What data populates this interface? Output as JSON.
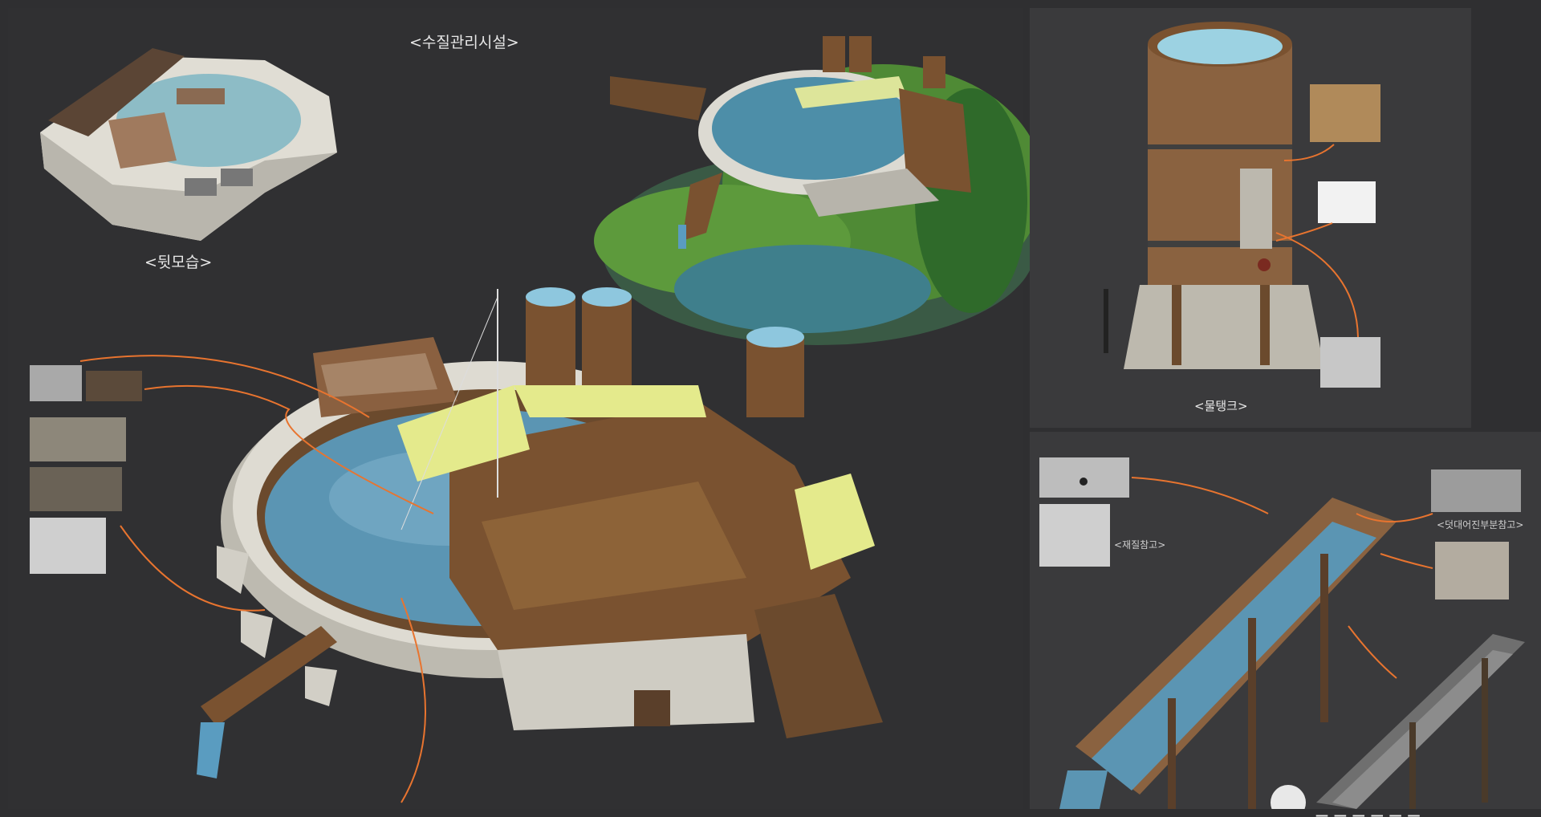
{
  "captions": {
    "main_title": "<수질관리시설>",
    "back_view": "<뒷모습>",
    "water_tank": "<물탱크>",
    "material_ref": "<재질참고>",
    "patched_ref": "<덧대어진부분참고>"
  },
  "watermark": {
    "text": "_ _ _ _ _ _"
  },
  "colors": {
    "background": "#2f2f31",
    "panel": "#3a3a3c",
    "water": "#5b95b3",
    "wood": "#7a5230",
    "concrete": "#d6d4cc",
    "awning": "#e4ea8c",
    "arrow": "#e8742f",
    "grass": "#4f8a35"
  }
}
